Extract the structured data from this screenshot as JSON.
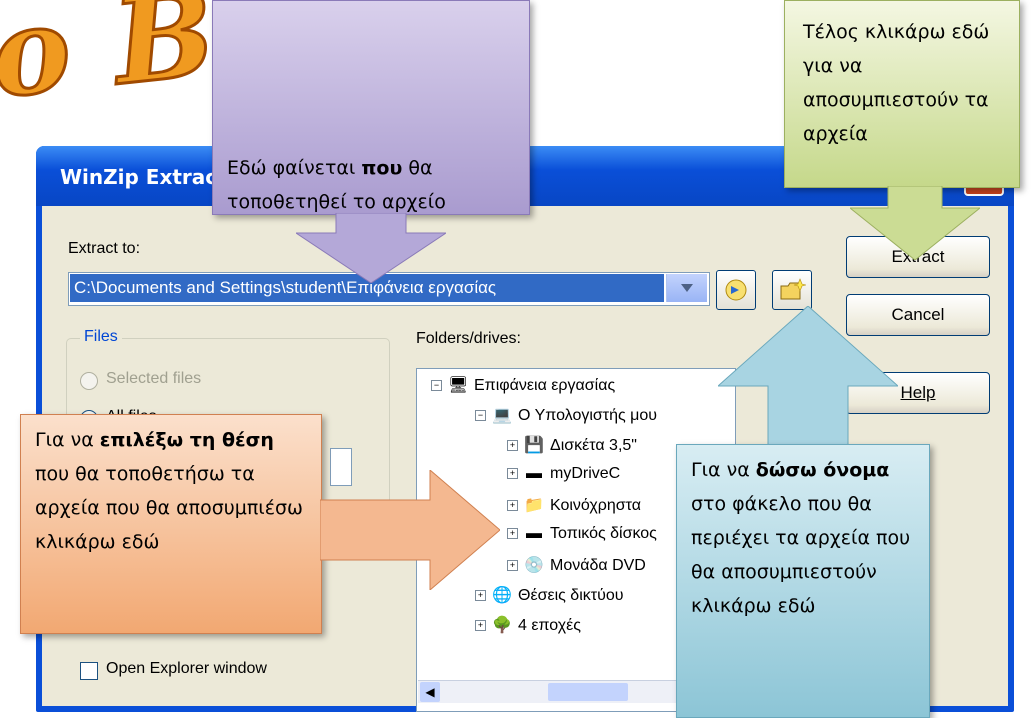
{
  "heading": {
    "text": "ο Βημα"
  },
  "window": {
    "title": "WinZip Extract",
    "close_glyph": "✕",
    "extract_to_label": "Extract to:",
    "path_value": "C:\\Documents and Settings\\student\\Επιφάνεια εργασίας",
    "files_group": "Files",
    "radio_selected": "Selected files",
    "radio_all": "All files",
    "folders_label": "Folders/drives:",
    "buttons": {
      "extract": "Extract",
      "cancel": "Cancel",
      "help": "Help"
    },
    "open_explorer_label": "Open Explorer window",
    "tree": [
      {
        "label": "Επιφάνεια εργασίας",
        "icon": "desktop-icon"
      },
      {
        "label": "Ο Υπολογιστής μου",
        "icon": "computer-icon"
      },
      {
        "label": "Δισκέτα 3,5\"",
        "icon": "floppy-icon"
      },
      {
        "label": "myDriveC",
        "icon": "drive-icon"
      },
      {
        "label": "Κοινόχρηστα",
        "icon": "folder-icon"
      },
      {
        "label": "Τοπικός δίσκος",
        "icon": "drive-icon"
      },
      {
        "label": "Μονάδα DVD",
        "icon": "cd-icon"
      },
      {
        "label": "Θέσεις δικτύου",
        "icon": "network-icon"
      },
      {
        "label": "4 εποχές",
        "icon": "tree-icon"
      }
    ]
  },
  "callouts": {
    "top_center": {
      "pre": "Εδώ φαίνεται ",
      "bold": "που",
      "post": " θα τοποθετηθεί το αρχείο"
    },
    "top_right": {
      "text": "Τέλος κλικάρω εδώ για να αποσυμπιεστούν τα αρχεία"
    },
    "left": {
      "pre": "Για να ",
      "bold": "επιλέξω τη θέση",
      "post": " που θα τοποθετήσω τα αρχεία που θα αποσυμπιέσω κλικάρω εδώ"
    },
    "right": {
      "pre": "Για να ",
      "bold": "δώσω όνομα",
      "post": " στο φάκελο που θα περιέχει τα αρχεία που  θα αποσυμπιεστούν κλικάρω εδώ"
    }
  },
  "colors": {
    "title_orange": "#f09a20",
    "xp_blue": "#0a4fd8",
    "selection": "#316ac5"
  }
}
